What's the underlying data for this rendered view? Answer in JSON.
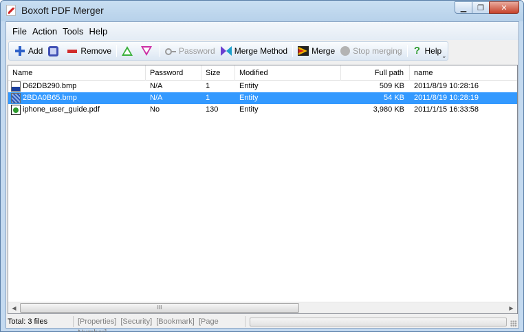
{
  "window": {
    "title": "Boxoft PDF Merger",
    "controls": {
      "minimize": "▁",
      "restore": "❐",
      "close": "✕"
    }
  },
  "menu": [
    {
      "label": "File"
    },
    {
      "label": "Action"
    },
    {
      "label": "Tools"
    },
    {
      "label": "Help"
    }
  ],
  "toolbar": {
    "add": "Add",
    "remove": "Remove",
    "password": "Password",
    "merge_method": "Merge Method",
    "merge": "Merge",
    "stop_merging": "Stop merging",
    "help": "Help",
    "overflow": "⌄"
  },
  "table": {
    "columns": [
      "Name",
      "Password",
      "Size",
      "Modified",
      "Full path",
      "name"
    ],
    "rows": [
      {
        "name": "D62DB290.bmp",
        "password": "N/A",
        "size": "1",
        "modified": "Entity",
        "full_path": "509 KB",
        "date": "2011/8/19 10:28:16",
        "icon": "bmp-file-icon",
        "selected": false
      },
      {
        "name": "2BDA0B65.bmp",
        "password": "N/A",
        "size": "1",
        "modified": "Entity",
        "full_path": "54 KB",
        "date": "2011/8/19 10:28:19",
        "icon": "bmp-file-icon",
        "selected": true
      },
      {
        "name": "iphone_user_guide.pdf",
        "password": "No",
        "size": "130",
        "modified": "Entity",
        "full_path": "3,980 KB",
        "date": "2011/1/15 16:33:58",
        "icon": "pdf-file-icon",
        "selected": false
      }
    ]
  },
  "scrollbar": {
    "left": "◀",
    "right": "▶",
    "grip": "III"
  },
  "status": {
    "total": "Total: 3 files",
    "links": [
      "[Properties]",
      "[Security]",
      "[Bookmark]",
      "[Page Number]"
    ]
  },
  "colors": {
    "selection": "#3399ff",
    "title_bar": "#c9dff2",
    "close_button": "#c7432b"
  }
}
